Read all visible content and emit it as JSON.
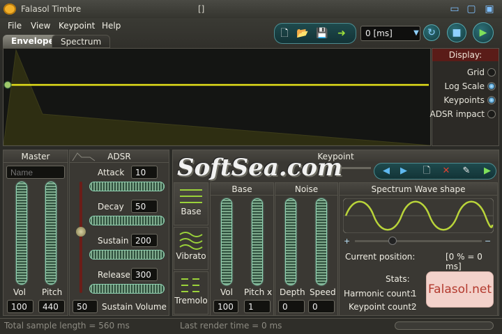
{
  "window": {
    "title": "Falasol Timbre",
    "title_mark": "[]"
  },
  "menu": [
    "File",
    "View",
    "Keypoint",
    "Help"
  ],
  "toolbar": {
    "time_value": "0 [ms]",
    "icons": [
      "new-file-icon",
      "open-folder-icon",
      "save-disk-icon",
      "export-arrow-icon"
    ]
  },
  "tabs": [
    "Envelope",
    "Spectrum"
  ],
  "display": {
    "title": "Display:",
    "options": [
      {
        "label": "Grid",
        "checked": false
      },
      {
        "label": "Log Scale",
        "checked": true
      },
      {
        "label": "Keypoints",
        "checked": true
      },
      {
        "label": "ADSR impact",
        "checked": false
      }
    ]
  },
  "master": {
    "title": "Master",
    "name_placeholder": "Name",
    "vol_label": "Vol",
    "pitch_label": "Pitch",
    "vol_value": "100",
    "pitch_value": "440"
  },
  "adsr": {
    "title": "ADSR",
    "attack_label": "Attack",
    "attack_value": "10",
    "decay_label": "Decay",
    "decay_value": "50",
    "sustain_label": "Sustain",
    "sustain_value": "200",
    "release_label": "Release",
    "release_value": "300",
    "sustain_volume_label": "Sustain Volume",
    "sustain_volume_value": "50"
  },
  "keypoint": {
    "title": "Keypoint",
    "wave_buttons": [
      "Base",
      "Vibrato",
      "Tremolo"
    ],
    "base": {
      "title": "Base",
      "vol_label": "Vol",
      "pitch_label": "Pitch x",
      "vol_value": "100",
      "pitch_value": "1"
    },
    "noise": {
      "title": "Noise",
      "depth_label": "Depth",
      "speed_label": "Speed",
      "depth_value": "0",
      "speed_value": "0"
    },
    "spectrum": {
      "title": "Spectrum Wave shape",
      "current_position_label": "Current position:",
      "current_position_value": "[0 % = 0 ms]",
      "stats_label": "Stats:",
      "harmonic_label": "Harmonic count:",
      "harmonic_value": "1",
      "keypoint_label": "Keypoint count:",
      "keypoint_value": "2"
    }
  },
  "logo": "Falasol.net",
  "watermark": "SoftSea.com",
  "status": {
    "total_length": "Total sample length = 560 ms",
    "render_time": "Last render time = 0 ms"
  },
  "colors": {
    "accent": "#e6e21a",
    "slider": "#8dd3b3",
    "logo_text": "#b33a2e"
  }
}
